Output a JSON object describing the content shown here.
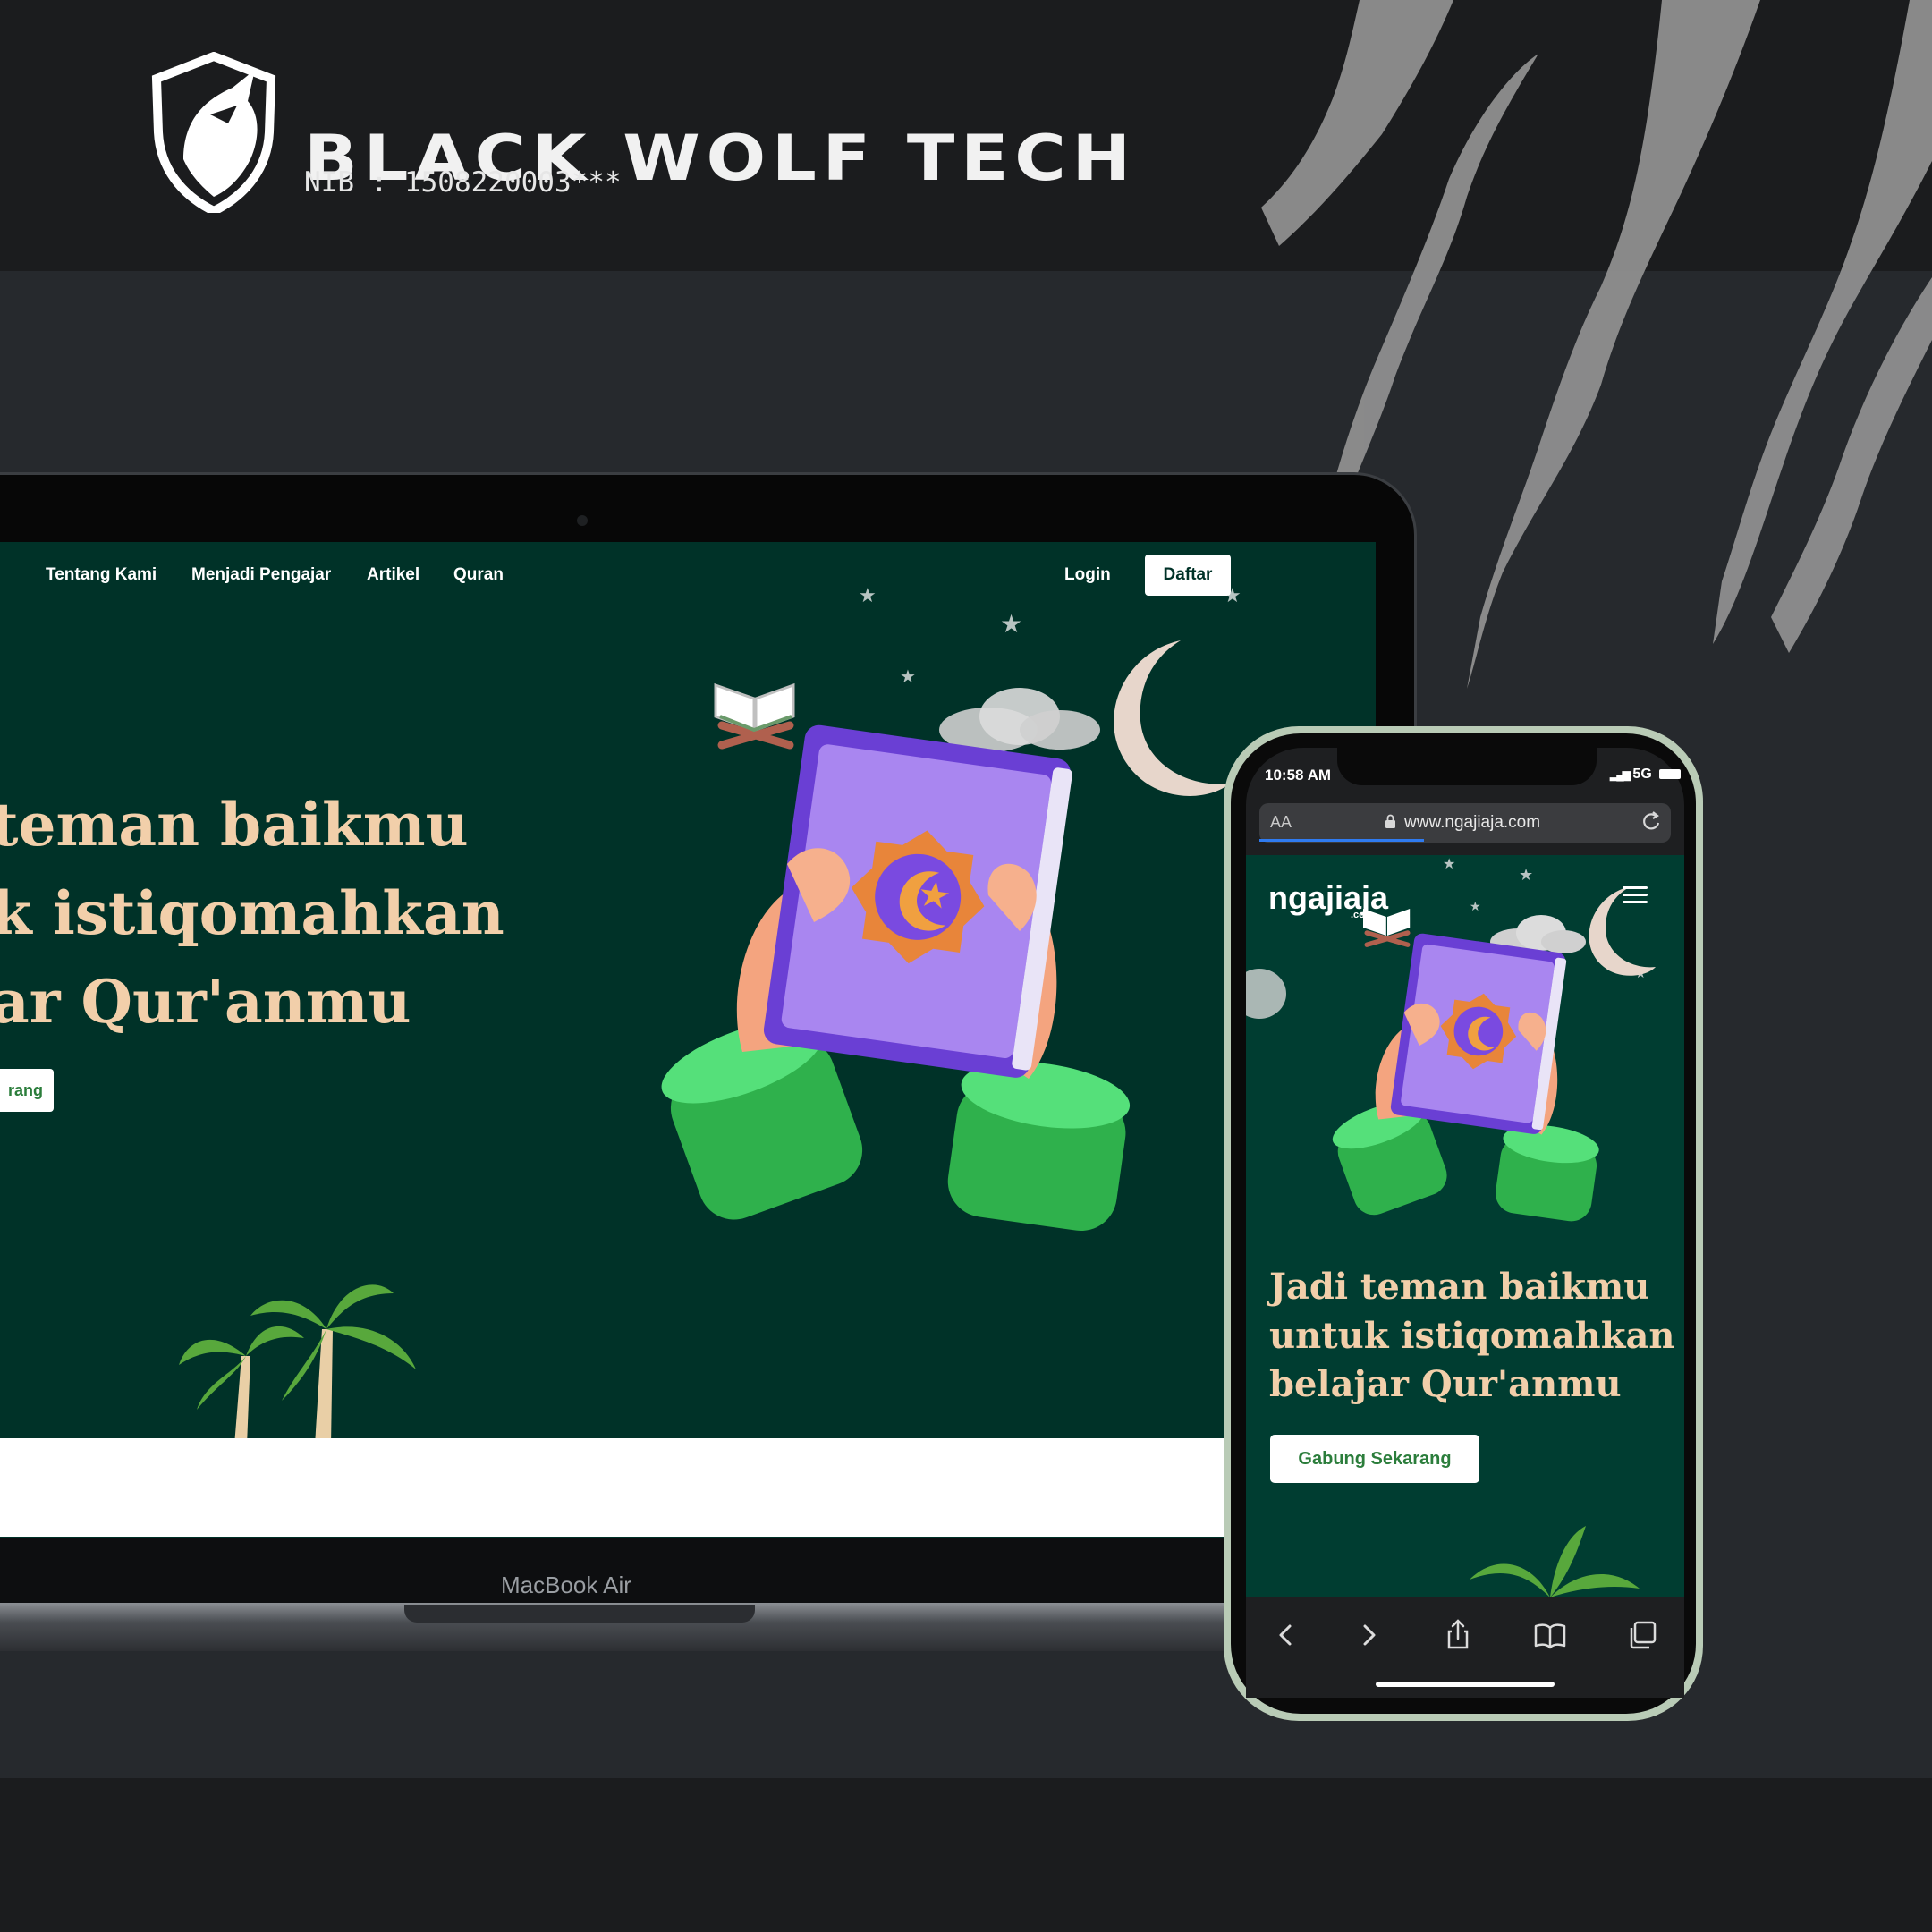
{
  "brand": {
    "name": "BLACK WOLF TECH",
    "nib": "NIB : 1508220003***"
  },
  "laptop": {
    "model_label": "MacBook Air",
    "nav": [
      "Tentang Kami",
      "Menjadi Pengajar",
      "Artikel",
      "Quran"
    ],
    "login_label": "Login",
    "register_label": "Daftar",
    "hero_lines": [
      "teman baikmu",
      "k istiqomahkan",
      "ar Qur'anmu"
    ],
    "cta_partial": "rang"
  },
  "phone": {
    "time": "10:58 AM",
    "network": "5G",
    "url_aa": "AA",
    "url": "www.ngajiaja.com",
    "logo": "ngajiaja",
    "logo_sub": ".com",
    "hero_lines": [
      "Jadi teman baikmu",
      "untuk istiqomahkan",
      "belajar Qur'anmu"
    ],
    "cta_label": "Gabung Sekarang",
    "page_load_progress": 0.4
  },
  "colors": {
    "site_green": "#003228",
    "hero_text": "#f2cfaa",
    "cta_text": "#2b7d3b",
    "book_purple": "#7b4de0",
    "sleeve_green": "#39c55a"
  },
  "icons": [
    "wolf-shield-logo",
    "quran-stand-icon",
    "quran-book-illustration",
    "crescent-moon-icon",
    "star-icon",
    "cloud-icon",
    "palm-tree-icon",
    "menu-icon",
    "lock-icon",
    "reload-icon",
    "back-icon",
    "forward-icon",
    "share-icon",
    "bookmarks-icon",
    "tabs-icon"
  ]
}
